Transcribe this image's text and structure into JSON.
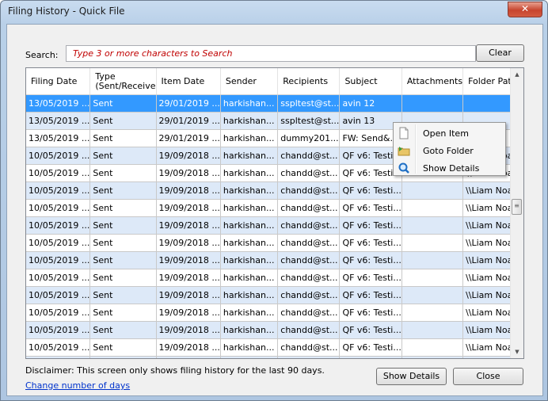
{
  "window": {
    "title": "Filing History - Quick File",
    "close_glyph": "✕"
  },
  "search": {
    "label": "Search:",
    "placeholder": "Type 3 or more characters to Search",
    "clear_label": "Clear"
  },
  "grid": {
    "columns": [
      {
        "key": "filing_date",
        "label": "Filing Date"
      },
      {
        "key": "type",
        "label": "Type (Sent/Receive"
      },
      {
        "key": "item_date",
        "label": "Item Date"
      },
      {
        "key": "sender",
        "label": "Sender"
      },
      {
        "key": "recipients",
        "label": "Recipients"
      },
      {
        "key": "subject",
        "label": "Subject"
      },
      {
        "key": "attachments",
        "label": "Attachments"
      },
      {
        "key": "folder_path",
        "label": "Folder Path"
      }
    ],
    "selected_row": 0,
    "rows": [
      [
        "13/05/2019 ...",
        "Sent",
        "29/01/2019 ...",
        "harkishan...",
        "sspltest@st...",
        "avin  12",
        "",
        ""
      ],
      [
        "13/05/2019 ...",
        "Sent",
        "29/01/2019 ...",
        "harkishan...",
        "sspltest@st...",
        "avin  13",
        "",
        ""
      ],
      [
        "13/05/2019 ...",
        "Sent",
        "29/01/2019 ...",
        "harkishan...",
        "dummy201...",
        "FW: Send&...",
        "",
        ""
      ],
      [
        "10/05/2019 ...",
        "Sent",
        "19/09/2018 ...",
        "harkishan...",
        "chandd@st...",
        "QF v6: Testi...",
        "",
        "\\\\Liam Noa..."
      ],
      [
        "10/05/2019 ...",
        "Sent",
        "19/09/2018 ...",
        "harkishan...",
        "chandd@st...",
        "QF v6: Testi...",
        "",
        "\\\\Liam Noa..."
      ],
      [
        "10/05/2019 ...",
        "Sent",
        "19/09/2018 ...",
        "harkishan...",
        "chandd@st...",
        "QF v6: Testi...",
        "",
        "\\\\Liam Noa..."
      ],
      [
        "10/05/2019 ...",
        "Sent",
        "19/09/2018 ...",
        "harkishan...",
        "chandd@st...",
        "QF v6: Testi...",
        "",
        "\\\\Liam Noa..."
      ],
      [
        "10/05/2019 ...",
        "Sent",
        "19/09/2018 ...",
        "harkishan...",
        "chandd@st...",
        "QF v6: Testi...",
        "",
        "\\\\Liam Noa..."
      ],
      [
        "10/05/2019 ...",
        "Sent",
        "19/09/2018 ...",
        "harkishan...",
        "chandd@st...",
        "QF v6: Testi...",
        "",
        "\\\\Liam Noa..."
      ],
      [
        "10/05/2019 ...",
        "Sent",
        "19/09/2018 ...",
        "harkishan...",
        "chandd@st...",
        "QF v6: Testi...",
        "",
        "\\\\Liam Noa..."
      ],
      [
        "10/05/2019 ...",
        "Sent",
        "19/09/2018 ...",
        "harkishan...",
        "chandd@st...",
        "QF v6: Testi...",
        "",
        "\\\\Liam Noa..."
      ],
      [
        "10/05/2019 ...",
        "Sent",
        "19/09/2018 ...",
        "harkishan...",
        "chandd@st...",
        "QF v6: Testi...",
        "",
        "\\\\Liam Noa..."
      ],
      [
        "10/05/2019 ...",
        "Sent",
        "19/09/2018 ...",
        "harkishan...",
        "chandd@st...",
        "QF v6: Testi...",
        "",
        "\\\\Liam Noa..."
      ],
      [
        "10/05/2019 ...",
        "Sent",
        "19/09/2018 ...",
        "harkishan...",
        "chandd@st...",
        "QF v6: Testi...",
        "",
        "\\\\Liam Noa..."
      ],
      [
        "10/05/2019 ...",
        "Sent",
        "19/09/2018 ...",
        "harkishan...",
        "chandd@st...",
        "QF v6: Testi...",
        "",
        "\\\\Liam Noa..."
      ],
      [
        "10/05/2019 ...",
        "Sent",
        "19/09/2018 ...",
        "harkishan...",
        "chandd@st...",
        "QF v6: Testi...",
        "",
        "\\\\Liam Noa..."
      ]
    ]
  },
  "context_menu": {
    "items": [
      {
        "label": "Open Item",
        "icon": "document-icon"
      },
      {
        "label": "Goto Folder",
        "icon": "folder-arrow-icon"
      },
      {
        "label": "Show Details",
        "icon": "magnifier-icon"
      }
    ]
  },
  "footer": {
    "disclaimer": "Disclaimer: This screen only shows filing history for the last 90 days.",
    "change_link": "Change number of days",
    "show_details_label": "Show Details",
    "close_label": "Close"
  },
  "colors": {
    "selected_row": "#3399ff",
    "alt_row": "#dde9f8",
    "placeholder_text": "#c00000",
    "link": "#0033cc"
  }
}
